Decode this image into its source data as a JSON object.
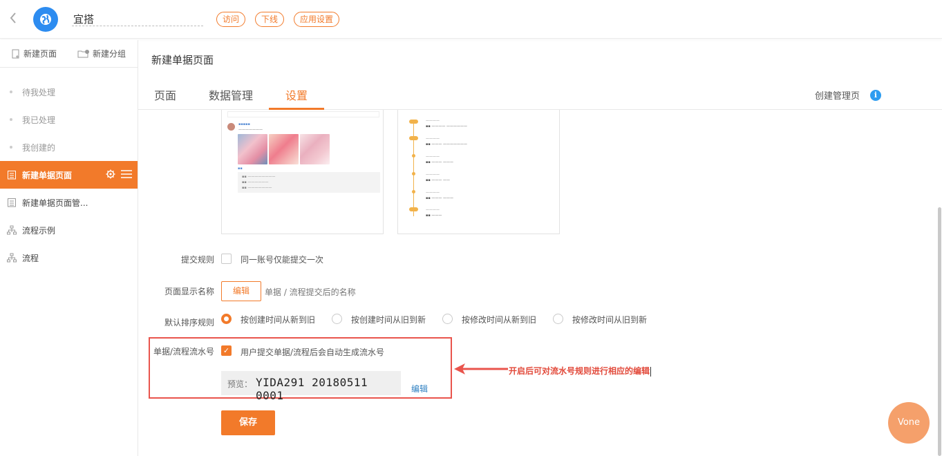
{
  "header": {
    "app_name": "宜搭",
    "buttons": [
      "访问",
      "下线",
      "应用设置"
    ]
  },
  "sidebar": {
    "actions": [
      "新建页面",
      "新建分组"
    ],
    "items": [
      {
        "label": "待我处理"
      },
      {
        "label": "我已处理"
      },
      {
        "label": "我创建的"
      },
      {
        "label": "新建单据页面"
      },
      {
        "label": "新建单据页面管..."
      },
      {
        "label": "流程示例"
      },
      {
        "label": "流程"
      }
    ]
  },
  "main": {
    "title": "新建单据页面",
    "tabs": [
      "页面",
      "数据管理",
      "设置"
    ],
    "active_tab": "设置",
    "create_manage_page": "创建管理页"
  },
  "form": {
    "submit_rule_label": "提交规则",
    "submit_rule_option": "同一账号仅能提交一次",
    "display_name_label": "页面显示名称",
    "edit_button": "编辑",
    "display_name_hint": "单据 / 流程提交后的名称",
    "sort_rule_label": "默认排序规则",
    "sort_options": [
      "按创建时间从新到旧",
      "按创建时间从旧到新",
      "按修改时间从新到旧",
      "按修改时间从旧到新"
    ],
    "serial_label": "单据/流程流水号",
    "serial_option": "用户提交单据/流程后会自动生成流水号",
    "preview_label": "预览：",
    "preview_value": "YIDA291 20180511 0001",
    "serial_edit_link": "编辑",
    "save_button": "保存"
  },
  "annotation": "开启后可对流水号规则进行相应的编辑",
  "floating_button": "Vone",
  "colors": {
    "accent": "#f27a2a",
    "annotation_red": "#e9544c",
    "logo_blue": "#2d8cf0"
  }
}
